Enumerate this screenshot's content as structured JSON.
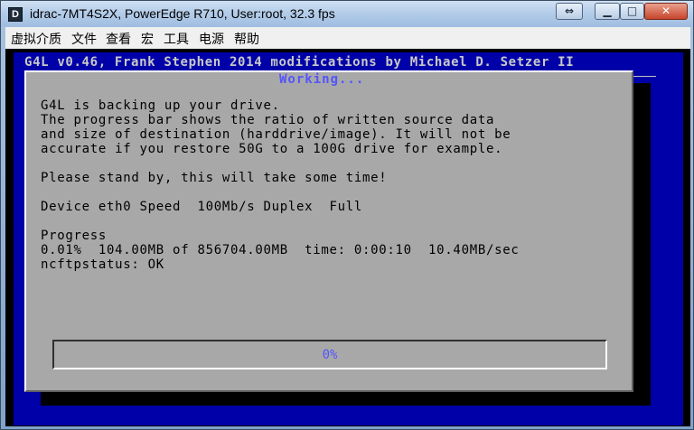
{
  "window": {
    "title": "idrac-7MT4S2X, PowerEdge R710, User:root, 32.3 fps",
    "icon_letter": "D",
    "restore_glyph": "⇔",
    "min_glyph": "▁",
    "max_glyph": "□",
    "close_glyph": "✕"
  },
  "menu": [
    "虚拟介质",
    "文件",
    "查看",
    "宏",
    "工具",
    "电源",
    "帮助"
  ],
  "console": {
    "header": "G4L v0.46, Frank Stephen 2014 modifications by Michael D. Setzer II",
    "dialog_title": "Working...",
    "lines": [
      "G4L is backing up your drive.",
      "The progress bar shows the ratio of written source data",
      "and size of destination (harddrive/image). It will not be",
      "accurate if you restore 50G to a 100G drive for example.",
      "",
      "Please stand by, this will take some time!",
      "",
      "Device eth0 Speed  100Mb/s Duplex  Full",
      "",
      "Progress",
      "0.01%  104.00MB of 856704.00MB  time: 0:00:10  10.40MB/sec",
      "ncftpstatus: OK"
    ],
    "progress_label": "0%",
    "progress_fraction": 0.0001
  },
  "colors": {
    "console_blue": "#0000a8",
    "dialog_gray": "#a8a8a8",
    "highlight_blue": "#5454fc"
  }
}
